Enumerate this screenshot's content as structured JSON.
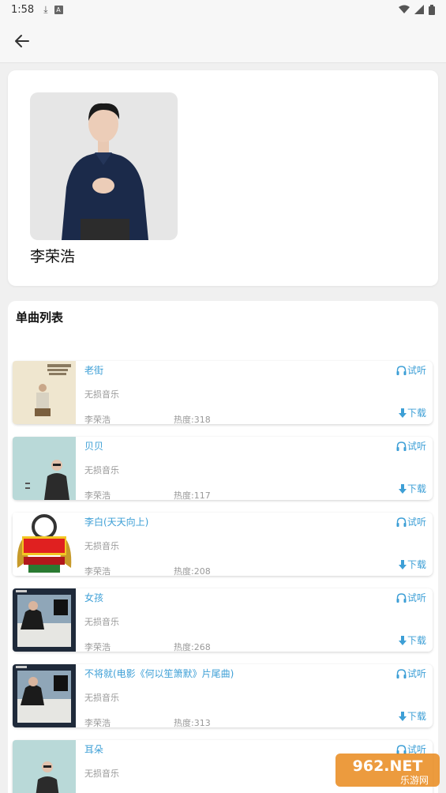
{
  "status_bar": {
    "time": "1:58"
  },
  "artist": {
    "name": "李荣浩"
  },
  "section_title": "单曲列表",
  "songs": [
    {
      "title": "老街",
      "quality": "无损音乐",
      "artist": "李荣浩",
      "heat": "热度:318",
      "trial": "试听",
      "download": "下载"
    },
    {
      "title": "贝贝",
      "quality": "无损音乐",
      "artist": "李荣浩",
      "heat": "热度:117",
      "trial": "试听",
      "download": "下载"
    },
    {
      "title": "李白(天天向上)",
      "quality": "无损音乐",
      "artist": "李荣浩",
      "heat": "热度:208",
      "trial": "试听",
      "download": "下载"
    },
    {
      "title": "女孩",
      "quality": "无损音乐",
      "artist": "李荣浩",
      "heat": "热度:268",
      "trial": "试听",
      "download": "下载"
    },
    {
      "title": "不将就(电影《何以笙箫默》片尾曲)",
      "quality": "无损音乐",
      "artist": "李荣浩",
      "heat": "热度:313",
      "trial": "试听",
      "download": "下载"
    },
    {
      "title": "耳朵",
      "quality": "无损音乐",
      "artist": "",
      "heat": "",
      "trial": "试听",
      "download": ""
    }
  ],
  "watermark": {
    "brand": "962.NET",
    "sub": "乐游网"
  },
  "colors": {
    "accent": "#3d9fd6",
    "background": "#f0f0f0",
    "card": "#ffffff"
  }
}
